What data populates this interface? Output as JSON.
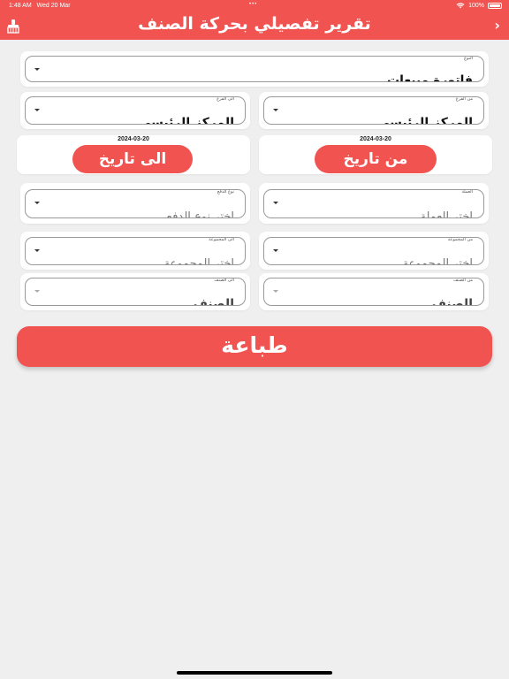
{
  "status_bar": {
    "time": "1:48 AM",
    "date": "Wed 20 Mar",
    "battery": "100%",
    "wifi_icon": "wifi-icon",
    "battery_icon": "battery-icon"
  },
  "header": {
    "title": "تقرير تفصيلي بحركة الصنف",
    "back_icon": "chevron-right-icon",
    "clean_icon": "broom-icon",
    "back_glyph": "›",
    "bg_color": "#f05350"
  },
  "form": {
    "type": {
      "label": "النوع",
      "value": "فاتورة مبيعات"
    },
    "from_branch": {
      "label": "من الفرع",
      "value": "المركز الرئيسي"
    },
    "to_branch": {
      "label": "الى الفرع",
      "value": "المركز الرئيسي"
    },
    "from_date": {
      "date": "2024-03-20",
      "button": "من تاريخ"
    },
    "to_date": {
      "date": "2024-03-20",
      "button": "الى تاريخ"
    },
    "currency": {
      "label": "العملة",
      "value": "اختر العملة"
    },
    "payment_type": {
      "label": "نوع الدفع",
      "value": "اختر نوع الدفع"
    },
    "from_group": {
      "label": "من المجموعة",
      "value": "اختر المجموعة"
    },
    "to_group": {
      "label": "الى المجموعة",
      "value": "اختر المجموعة"
    },
    "from_item": {
      "label": "من الصنف",
      "value": "الصنف"
    },
    "to_item": {
      "label": "الى الصنف",
      "value": "الصنف"
    }
  },
  "print_button": "طباعة",
  "accent_color": "#f05350"
}
